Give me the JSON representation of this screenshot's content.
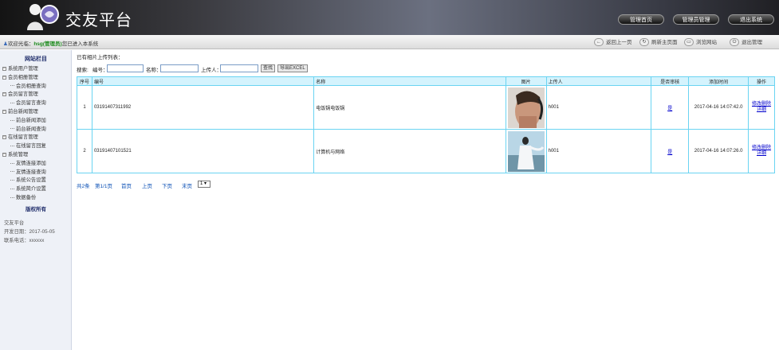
{
  "header": {
    "title": "交友平台",
    "nav": [
      "管理首页",
      "管理员管理",
      "退出系统"
    ]
  },
  "toolbar": {
    "welcome_prefix": "欢迎光临：",
    "user": "hsg(管理员)",
    "welcome_suffix": "您已进入本系统",
    "buttons": [
      "返回上一页",
      "刷新主页面",
      "浏览网站",
      "退出管理"
    ]
  },
  "sidebar": {
    "title": "网站栏目",
    "tree": [
      {
        "label": "系统用户管理",
        "level": 0
      },
      {
        "label": "会员相册管理",
        "level": 0
      },
      {
        "label": "会员相册查询",
        "level": 1
      },
      {
        "label": "会员留言管理",
        "level": 0
      },
      {
        "label": "会员留言查询",
        "level": 1
      },
      {
        "label": "前台新闻管理",
        "level": 0
      },
      {
        "label": "前台新闻添加",
        "level": 1
      },
      {
        "label": "前台新闻查询",
        "level": 1
      },
      {
        "label": "在线留言管理",
        "level": 0
      },
      {
        "label": "在线留言回复",
        "level": 1
      },
      {
        "label": "系统管理",
        "level": 0
      },
      {
        "label": "友情连接添加",
        "level": 1
      },
      {
        "label": "友情连接查询",
        "level": 1
      },
      {
        "label": "系统公告设置",
        "level": 1
      },
      {
        "label": "系统简介设置",
        "level": 1
      },
      {
        "label": "数据备份",
        "level": 1
      }
    ],
    "copyright": "版权所有",
    "info": [
      "交友平台",
      "开发日期：2017-05-05",
      "联系电话：xxxxxx"
    ]
  },
  "main": {
    "list_title": "已有相片上传列表：",
    "search": {
      "label": "搜索:",
      "code_label": "编号：",
      "name_label": "名称：",
      "uploader_label": "上传人：",
      "search_btn": "查找",
      "export_btn": "导出EXCEL"
    },
    "columns": [
      "序号",
      "编号",
      "名称",
      "图片",
      "上传人",
      "是否审核",
      "添加时间",
      "操作"
    ],
    "rows": [
      {
        "no": "1",
        "code": "03191407311992",
        "name": "电饭锅电饭锅",
        "uploader": "h001",
        "review": "是",
        "time": "2017-04-16 14:07:42.0",
        "op1": "修改",
        "op2": "删除",
        "op3": "详细"
      },
      {
        "no": "2",
        "code": "03191407101521",
        "name": "计算机与网络",
        "uploader": "h001",
        "review": "是",
        "time": "2017-04-16 14:07:26.0",
        "op1": "修改",
        "op2": "删除",
        "op3": "详细"
      }
    ],
    "pager": {
      "total": "共2条",
      "page": "第1/1页",
      "first": "首页",
      "prev": "上页",
      "next": "下页",
      "last": "末页",
      "select": "1"
    }
  },
  "colors": {
    "table_border": "#6ad4f2",
    "table_header_bg": "#d4f3fd",
    "link": "#0000cc",
    "user_green": "#1a8a1a"
  }
}
